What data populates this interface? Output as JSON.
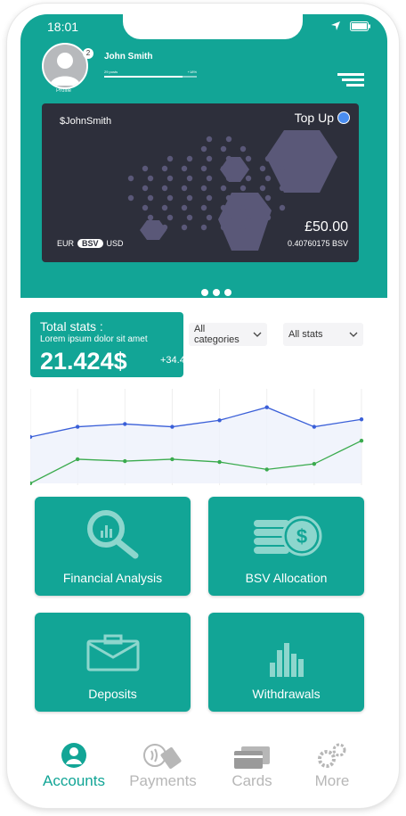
{
  "status_bar": {
    "time": "18:01"
  },
  "profile": {
    "name": "John Smith",
    "badge": "2",
    "caption": "Profile",
    "progress_left": "29 posts",
    "progress_right": "+18%",
    "progress_fraction": 0.85
  },
  "card": {
    "holder": "$JohnSmith",
    "topup": "Top Up",
    "cur_left": "EUR",
    "cur_active": "BSV",
    "cur_right": "USD",
    "amount": "£50.00",
    "bsv": "0.40760175 BSV"
  },
  "stats": {
    "title": "Total stats :",
    "subtitle": "Lorem ipsum dolor sit amet",
    "value": "21.424$",
    "change": "+34.4%"
  },
  "filters": {
    "categories": "All categories",
    "stats": "All stats"
  },
  "chart_data": {
    "type": "line",
    "x": [
      0,
      1,
      2,
      3,
      4,
      5,
      6,
      7
    ],
    "series": [
      {
        "color": "#3a5fd8",
        "values": [
          5.0,
          6.1,
          6.4,
          6.1,
          6.8,
          8.2,
          6.1,
          6.9
        ]
      },
      {
        "color": "#3bab4e",
        "values": [
          0.0,
          2.6,
          2.4,
          2.6,
          2.3,
          1.5,
          2.1,
          4.6
        ]
      }
    ],
    "ylim": [
      0,
      10
    ],
    "grid": true
  },
  "tiles": {
    "financial": "Financial Analysis",
    "bsv_allocation": "BSV Allocation",
    "deposits": "Deposits",
    "withdrawals": "Withdrawals"
  },
  "tabs": {
    "accounts": "Accounts",
    "payments": "Payments",
    "cards": "Cards",
    "more": "More"
  },
  "colors": {
    "primary": "#12a596",
    "card": "#2d2f3b",
    "inactive": "#b7b7b7"
  }
}
